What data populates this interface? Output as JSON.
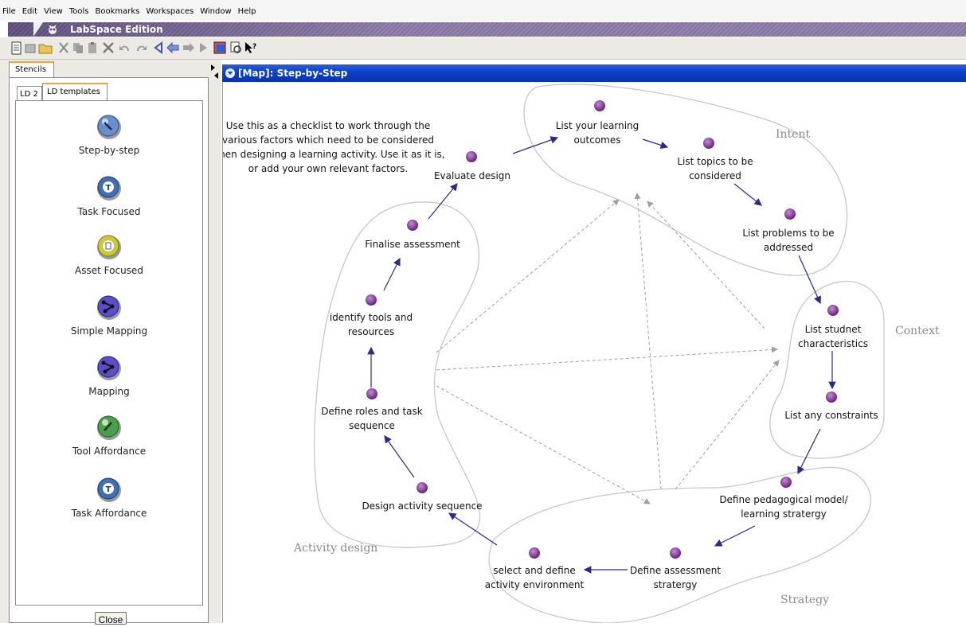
{
  "menu": [
    "File",
    "Edit",
    "View",
    "Tools",
    "Bookmarks",
    "Workspaces",
    "Window",
    "Help"
  ],
  "app_title": "LabSpace Edition",
  "stencils_tab": "Stencils",
  "subtabs": {
    "ld2": "LD 2",
    "templates": "LD templates"
  },
  "stencils": [
    {
      "label": "Step-by-step",
      "icon": "step-by-step-icon",
      "color": "#6a8fc6"
    },
    {
      "label": "Task Focused",
      "icon": "task-focused-icon",
      "color": "#3f6fb5"
    },
    {
      "label": "Asset Focused",
      "icon": "asset-focused-icon",
      "color": "#c8c83a"
    },
    {
      "label": "Simple Mapping",
      "icon": "simple-mapping-icon",
      "color": "#5a4fc8"
    },
    {
      "label": "Mapping",
      "icon": "mapping-icon",
      "color": "#5a4fc8"
    },
    {
      "label": "Tool Affordance",
      "icon": "tool-affordance-icon",
      "color": "#4aa04a"
    },
    {
      "label": "Task Affordance",
      "icon": "task-affordance-icon",
      "color": "#3f6fb5"
    }
  ],
  "close_label": "Close",
  "map": {
    "title": "[Map]: Step-by-Step",
    "note": "Use this as a checklist to work through the various factors which need to be considered when designing a learning activity. Use it as it is, or add your own relevant factors.",
    "regions": {
      "intent": "Intent",
      "context": "Context",
      "strategy": "Strategy",
      "activity": "Activity design"
    },
    "nodes": [
      {
        "id": "n1",
        "label": [
          "List your learning",
          "outcomes"
        ]
      },
      {
        "id": "n2",
        "label": [
          "List topics to be",
          "considered"
        ]
      },
      {
        "id": "n3",
        "label": [
          "List problems to be",
          "addressed"
        ]
      },
      {
        "id": "n4",
        "label": [
          "List studnet",
          "characteristics"
        ]
      },
      {
        "id": "n5",
        "label": [
          "List any constraints"
        ]
      },
      {
        "id": "n6",
        "label": [
          "Define pedagogical model/",
          "learning stratergy"
        ]
      },
      {
        "id": "n7",
        "label": [
          "Define assessment",
          "stratergy"
        ]
      },
      {
        "id": "n8",
        "label": [
          "select and define",
          "activity environment"
        ]
      },
      {
        "id": "n9",
        "label": [
          "Design activity sequence"
        ]
      },
      {
        "id": "n10",
        "label": [
          "Define roles and task",
          "sequence"
        ]
      },
      {
        "id": "n11",
        "label": [
          "identify tools and",
          "resources"
        ]
      },
      {
        "id": "n12",
        "label": [
          "Finalise assessment"
        ]
      },
      {
        "id": "n13",
        "label": [
          "Evaluate design"
        ]
      }
    ]
  },
  "colors": {
    "titlebar": "#7b6b9a",
    "map_title": "#0a3dc7",
    "node_icon": "#8a3c9c",
    "arrow": "#2a2a8a"
  }
}
